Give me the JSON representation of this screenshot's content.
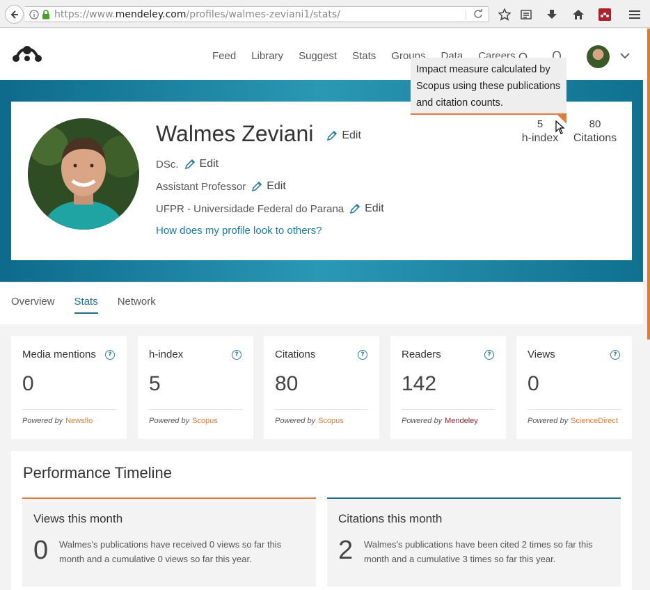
{
  "browser": {
    "url_prefix": "https://www.",
    "url_domain": "mendeley.com",
    "url_path": "/profiles/walmes-zeviani1/stats/"
  },
  "nav": {
    "items": [
      "Feed",
      "Library",
      "Suggest",
      "Stats",
      "Groups",
      "Data",
      "Careers"
    ]
  },
  "profile": {
    "name": "Walmes Zeviani",
    "edit_label": "Edit",
    "degree": "DSc.",
    "position": "Assistant Professor",
    "institution": "UFPR - Universidade Federal do Parana",
    "view_link": "How does my profile look to others?",
    "h_index_value": "5",
    "h_index_label": "h-index",
    "citations_value": "80",
    "citations_label": "Citations"
  },
  "tooltip": {
    "text": "Impact measure calculated by Scopus using these publications and citation counts."
  },
  "tabs": [
    "Overview",
    "Stats",
    "Network"
  ],
  "stats": [
    {
      "title": "Media mentions",
      "value": "0",
      "powered_label": "Powered by",
      "source": "Newsflo",
      "source_color": "#e07a3a"
    },
    {
      "title": "h-index",
      "value": "5",
      "powered_label": "Powered by",
      "source": "Scopus",
      "source_color": "#e07a3a"
    },
    {
      "title": "Citations",
      "value": "80",
      "powered_label": "Powered by",
      "source": "Scopus",
      "source_color": "#e07a3a"
    },
    {
      "title": "Readers",
      "value": "142",
      "powered_label": "Powered by",
      "source": "Mendeley",
      "source_color": "#9e1f2b"
    },
    {
      "title": "Views",
      "value": "0",
      "powered_label": "Powered by",
      "source": "ScienceDirect",
      "source_color": "#e07a3a"
    }
  ],
  "performance": {
    "heading": "Performance Timeline",
    "views": {
      "title": "Views this month",
      "value": "0",
      "desc": "Walmes's publications have received 0 views so far this month and a cumulative 0 views so far this year.",
      "accent": "#e07a3a"
    },
    "citations": {
      "title": "Citations this month",
      "value": "2",
      "desc": "Walmes's publications have been cited 2 times so far this month and a cumulative 3 times so far this year.",
      "accent": "#1e6f8e"
    }
  },
  "colors": {
    "accent_teal": "#1e6f8e",
    "accent_orange": "#e07a3a"
  },
  "icons": [
    "back-arrow-icon",
    "info-icon",
    "lock-icon",
    "reload-icon",
    "bookmark-star-icon",
    "reading-list-icon",
    "download-icon",
    "home-icon",
    "mendeley-extension-icon",
    "hamburger-menu-icon",
    "search-icon",
    "bell-icon",
    "chevron-down-icon",
    "pencil-icon",
    "help-icon",
    "mouse-cursor-icon"
  ]
}
